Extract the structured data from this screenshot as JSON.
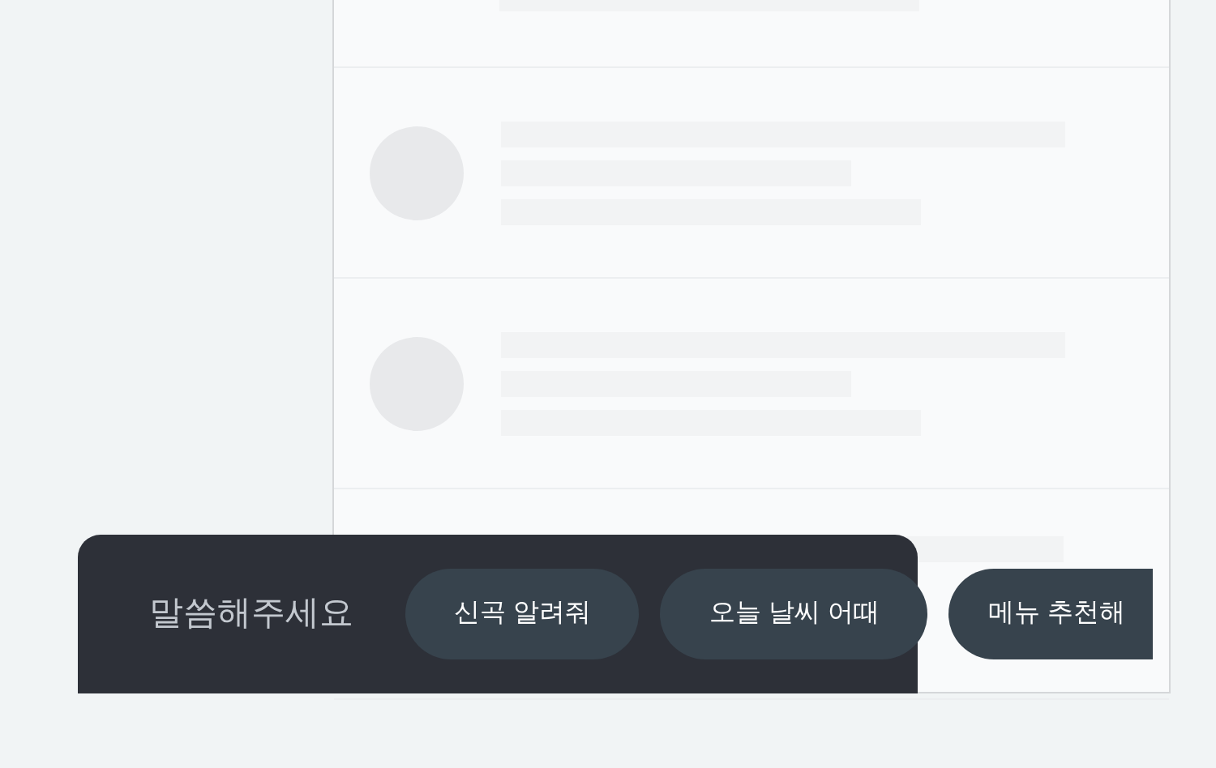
{
  "list": {
    "items": [
      {
        "kind": "cut"
      },
      {
        "kind": "avatar"
      },
      {
        "kind": "avatar"
      },
      {
        "kind": "partial"
      }
    ]
  },
  "voice_bar": {
    "prompt": "말씀해주세요",
    "suggestions": [
      {
        "label": "신곡 알려줘"
      },
      {
        "label": "오늘 날씨 어때"
      },
      {
        "label": "메뉴 추천해"
      }
    ]
  }
}
